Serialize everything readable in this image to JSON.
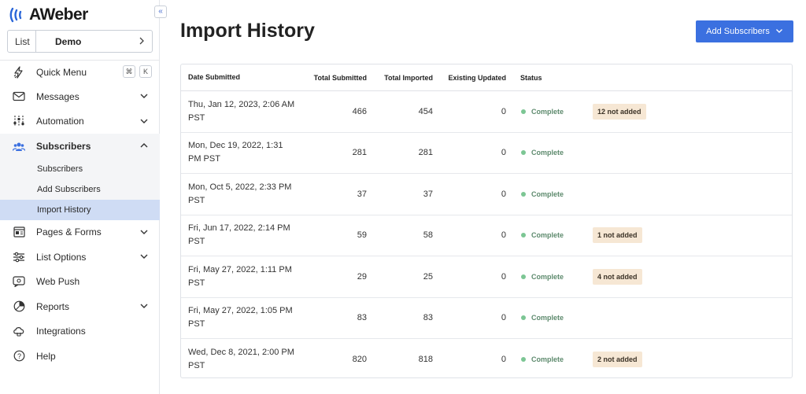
{
  "brand": {
    "logo_text": "AWeber",
    "accent": "#3b70e0"
  },
  "list_selector": {
    "label": "List",
    "value": "Demo"
  },
  "nav": {
    "items": [
      {
        "key": "quick-menu",
        "label": "Quick Menu",
        "icon": "bolt-icon",
        "shortcut": [
          "⌘",
          "K"
        ]
      },
      {
        "key": "messages",
        "label": "Messages",
        "icon": "envelope-icon",
        "expandable": true
      },
      {
        "key": "automation",
        "label": "Automation",
        "icon": "sliders-icon",
        "expandable": true
      },
      {
        "key": "subscribers",
        "label": "Subscribers",
        "icon": "people-icon",
        "expandable": true,
        "expanded": true
      },
      {
        "key": "pages-forms",
        "label": "Pages & Forms",
        "icon": "layout-icon",
        "expandable": true
      },
      {
        "key": "list-options",
        "label": "List Options",
        "icon": "toggles-icon",
        "expandable": true
      },
      {
        "key": "web-push",
        "label": "Web Push",
        "icon": "chat-icon"
      },
      {
        "key": "reports",
        "label": "Reports",
        "icon": "pie-chart-icon",
        "expandable": true
      },
      {
        "key": "integrations",
        "label": "Integrations",
        "icon": "cloud-icon"
      },
      {
        "key": "help",
        "label": "Help",
        "icon": "question-icon"
      }
    ],
    "subscribers_sub": [
      "Subscribers",
      "Add Subscribers",
      "Import History"
    ]
  },
  "page": {
    "title": "Import History",
    "add_button": "Add Subscribers"
  },
  "table": {
    "columns": [
      "Date Submitted",
      "Total Submitted",
      "Total Imported",
      "Existing Updated",
      "Status"
    ],
    "rows": [
      {
        "date_line1": "Thu, Jan 12, 2023, 2:06 AM",
        "date_line2": "PST",
        "submitted": "466",
        "imported": "454",
        "existing": "0",
        "status": "Complete",
        "note": "12 not added"
      },
      {
        "date_line1": "Mon, Dec 19, 2022, 1:31",
        "date_line2": "PM PST",
        "submitted": "281",
        "imported": "281",
        "existing": "0",
        "status": "Complete",
        "note": ""
      },
      {
        "date_line1": "Mon, Oct 5, 2022, 2:33 PM",
        "date_line2": "PST",
        "submitted": "37",
        "imported": "37",
        "existing": "0",
        "status": "Complete",
        "note": ""
      },
      {
        "date_line1": "Fri, Jun 17, 2022, 2:14 PM",
        "date_line2": "PST",
        "submitted": "59",
        "imported": "58",
        "existing": "0",
        "status": "Complete",
        "note": "1 not added"
      },
      {
        "date_line1": "Fri, May 27, 2022, 1:11 PM",
        "date_line2": "PST",
        "submitted": "29",
        "imported": "25",
        "existing": "0",
        "status": "Complete",
        "note": "4 not added"
      },
      {
        "date_line1": "Fri, May 27, 2022, 1:05 PM",
        "date_line2": "PST",
        "submitted": "83",
        "imported": "83",
        "existing": "0",
        "status": "Complete",
        "note": ""
      },
      {
        "date_line1": "Wed, Dec 8, 2021, 2:00 PM",
        "date_line2": "PST",
        "submitted": "820",
        "imported": "818",
        "existing": "0",
        "status": "Complete",
        "note": "2 not added"
      }
    ]
  }
}
